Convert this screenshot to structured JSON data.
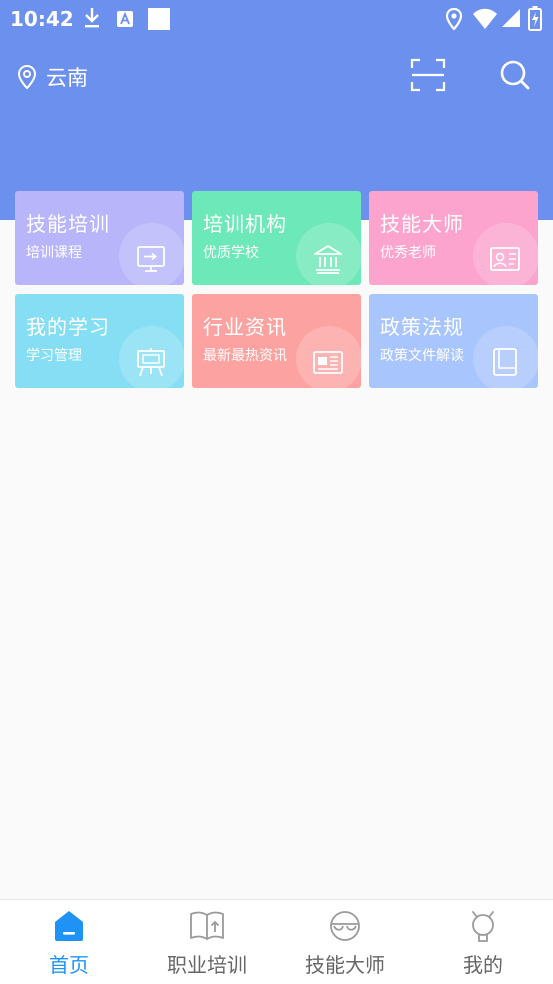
{
  "status_bar": {
    "time": "10:42"
  },
  "header": {
    "location": "云南",
    "scan_icon": "scan-icon",
    "search_icon": "search-icon"
  },
  "tiles": [
    {
      "title": "技能培训",
      "subtitle": "培训课程",
      "color": "#b8b5fb",
      "icon": "monitor-arrow-icon"
    },
    {
      "title": "培训机构",
      "subtitle": "优质学校",
      "color": "#6de8b8",
      "icon": "institution-icon"
    },
    {
      "title": "技能大师",
      "subtitle": "优秀老师",
      "color": "#fca4cd",
      "icon": "id-card-icon"
    },
    {
      "title": "我的学习",
      "subtitle": "学习管理",
      "color": "#86def4",
      "icon": "easel-icon"
    },
    {
      "title": "行业资讯",
      "subtitle": "最新最热资讯",
      "color": "#fca3a1",
      "icon": "newspaper-icon"
    },
    {
      "title": "政策法规",
      "subtitle": "政策文件解读",
      "color": "#a9c5fd",
      "icon": "book-icon"
    }
  ],
  "bottom_nav": [
    {
      "label": "首页",
      "icon": "home-icon",
      "active": true
    },
    {
      "label": "职业培训",
      "icon": "open-book-icon",
      "active": false
    },
    {
      "label": "技能大师",
      "icon": "master-icon",
      "active": false
    },
    {
      "label": "我的",
      "icon": "profile-icon",
      "active": false
    }
  ],
  "colors": {
    "header": "#6b90ee",
    "active": "#1f93f5",
    "inactive": "#666666"
  }
}
